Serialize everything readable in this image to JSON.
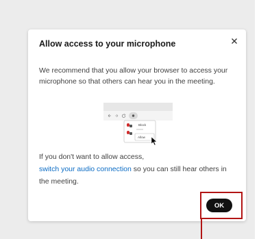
{
  "dialog": {
    "title": "Allow access to your microphone",
    "body": "We recommend that you allow your browser to access your microphone so that others can hear you in the meeting.",
    "bottom_before_link": "If you don't want to allow access,",
    "link_text": "switch your audio connection",
    "bottom_after_link": " so you can still hear others in the meeting.",
    "ok_label": "OK"
  },
  "illustration": {
    "block_label": "Block",
    "allow_label": "Allow"
  },
  "colors": {
    "background": "#ececec",
    "dialog": "#ffffff",
    "link": "#0a6bc4",
    "button": "#111111",
    "highlight": "#b21414"
  },
  "icons": [
    "close-icon",
    "browser-back-icon",
    "browser-forward-icon",
    "browser-reload-icon",
    "microphone-icon",
    "mouse-cursor-icon"
  ]
}
